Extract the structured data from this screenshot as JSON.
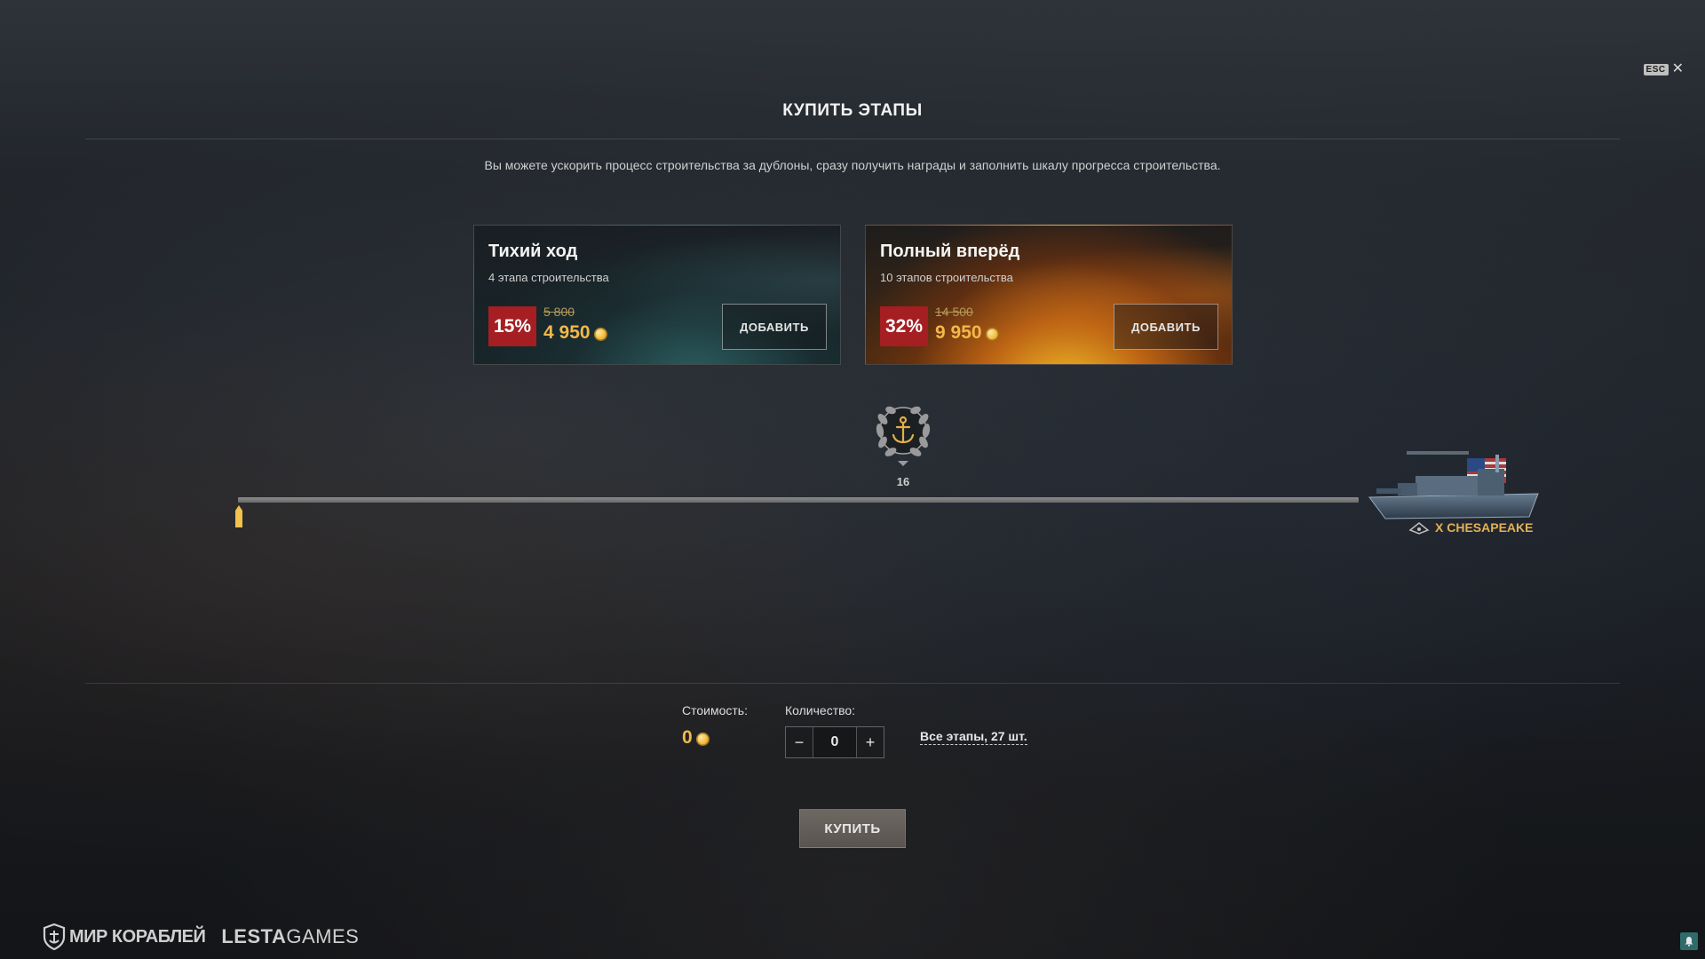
{
  "header": {
    "esc_label": "ESC",
    "close_glyph": "✕",
    "title": "КУПИТЬ ЭТАПЫ",
    "description": "Вы можете ускорить процесс строительства за дублоны, сразу получить награды и заполнить шкалу прогресса строительства."
  },
  "offers": [
    {
      "title": "Тихий ход",
      "subtitle": "4 этапа строительства",
      "discount": "15%",
      "old_price": "5 800",
      "new_price": "4 950",
      "button_label": "ДОБАВИТЬ"
    },
    {
      "title": "Полный вперёд",
      "subtitle": "10 этапов строительства",
      "discount": "32%",
      "old_price": "14 500",
      "new_price": "9 950",
      "button_label": "ДОБАВИТЬ"
    }
  ],
  "progress": {
    "milestone_label": "16",
    "current_stage": 0,
    "total_stages": 27
  },
  "ship": {
    "tier": "X",
    "name": "CHESAPEAKE",
    "display_name": "X CHESAPEAKE"
  },
  "purchase": {
    "cost_label": "Стоимость:",
    "cost_value": "0",
    "quantity_label": "Количество:",
    "quantity_value": "0",
    "minus_glyph": "−",
    "plus_glyph": "+",
    "all_stages_label": "Все этапы, 27 шт.",
    "buy_label": "КУПИТЬ"
  },
  "footer": {
    "game_logo": "МИР КОРАБЛЕЙ",
    "publisher_bold": "LESTA",
    "publisher_light": "GAMES"
  },
  "icons": {
    "currency": "doubloon-coin-icon",
    "milestone": "anchor-laurel-icon",
    "notification": "bell-icon"
  },
  "colors": {
    "gold": "#f2b84b",
    "discount_red": "#a51e22",
    "calm_accent": "#3c8c8c",
    "full_accent": "#e67814"
  }
}
